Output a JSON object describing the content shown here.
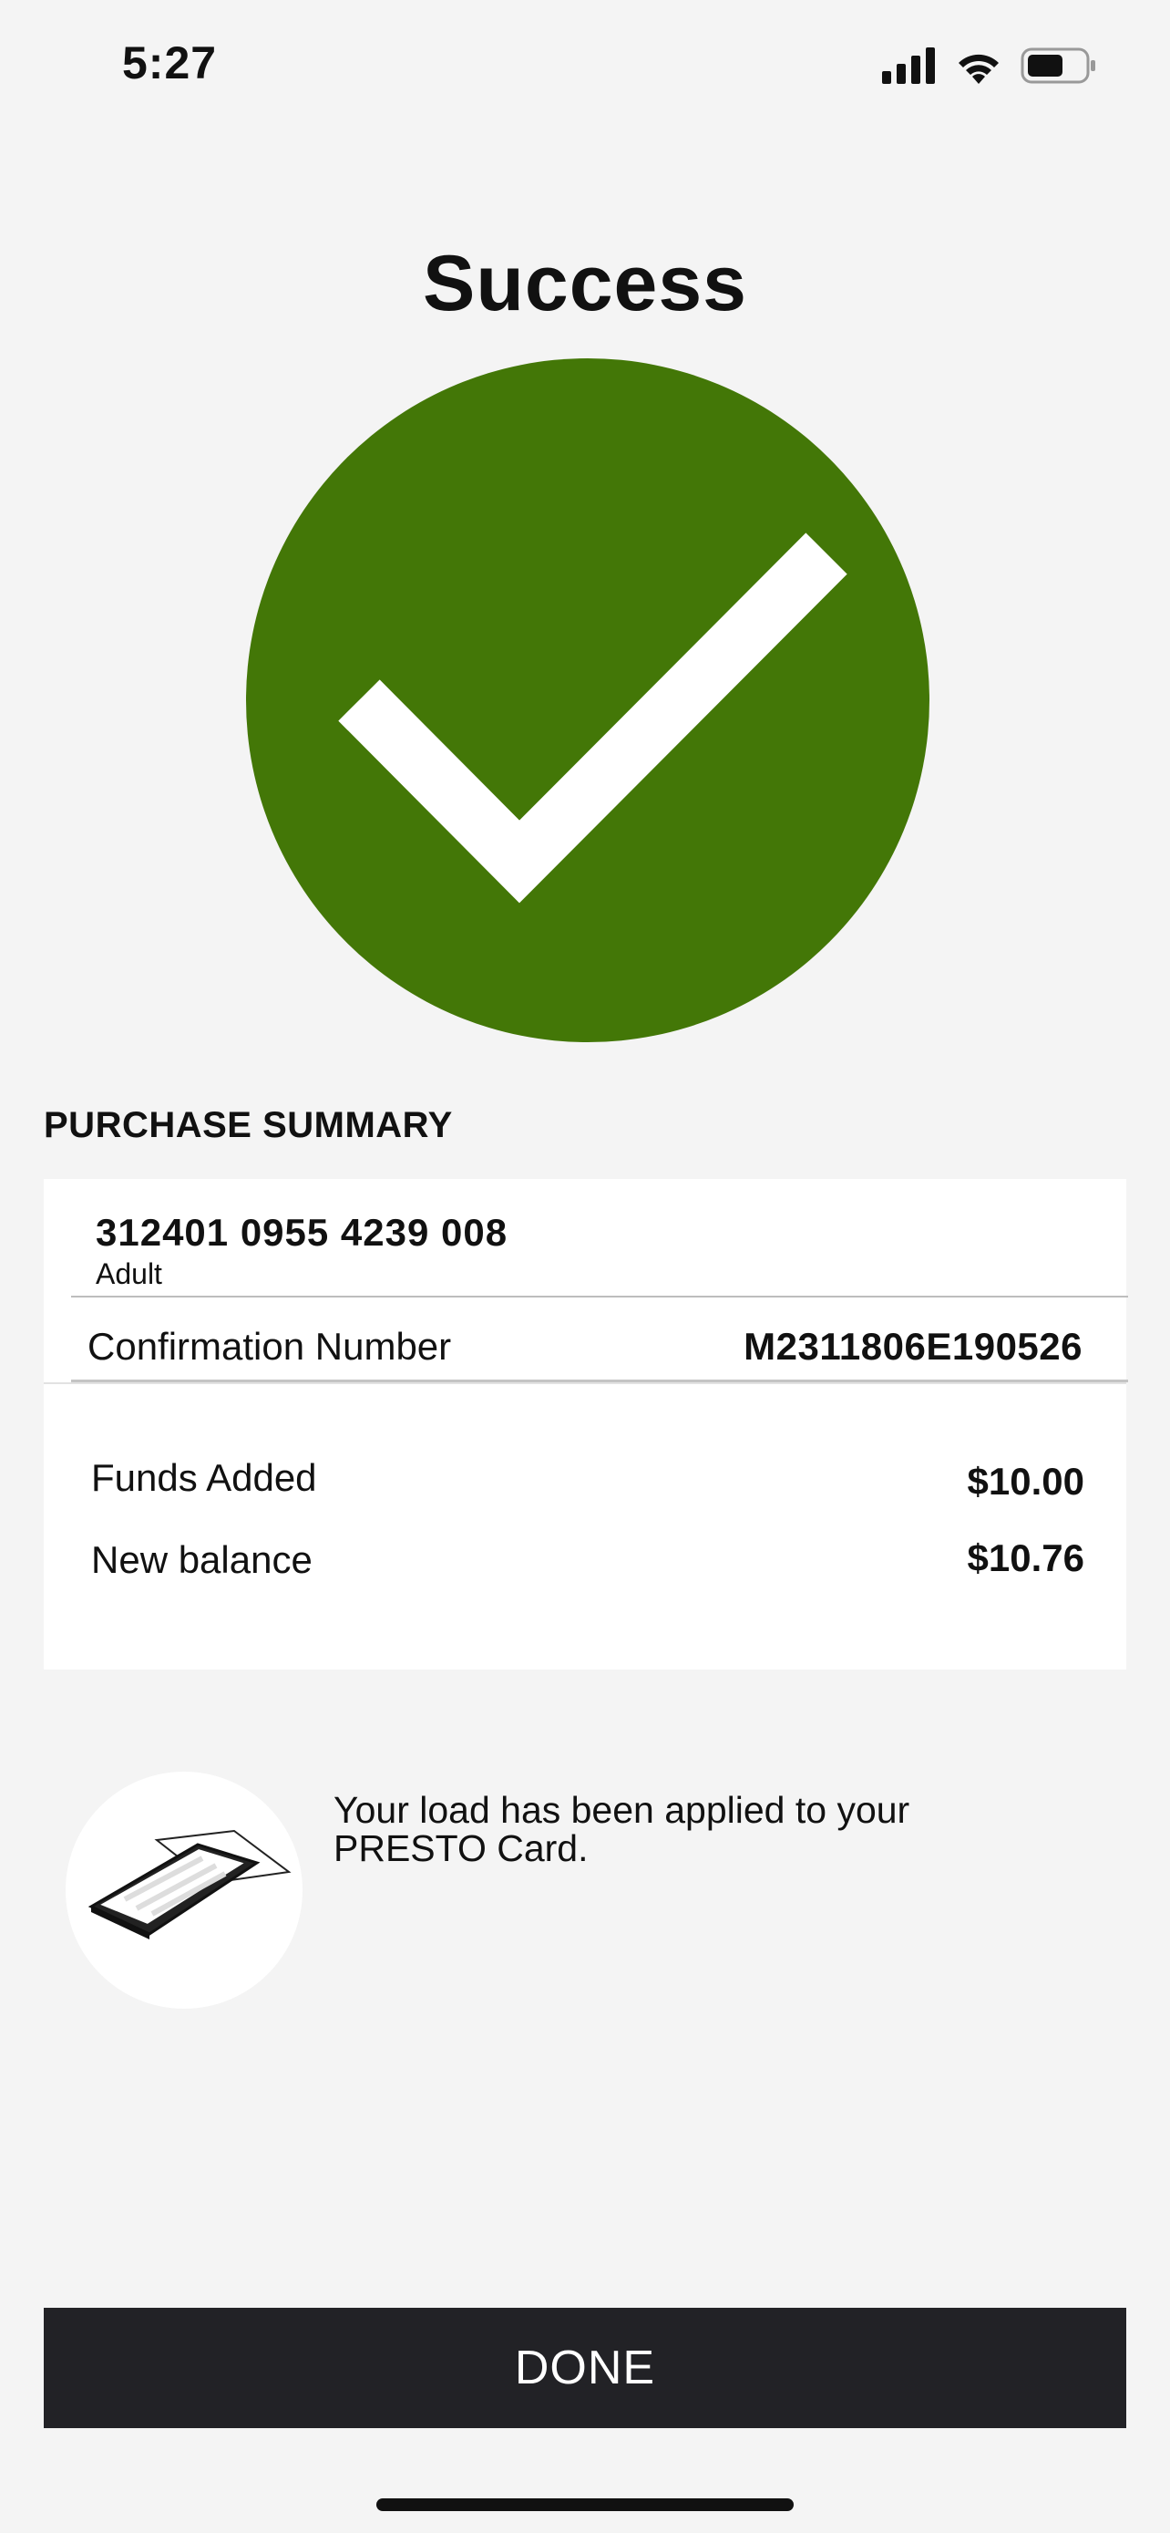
{
  "status_bar": {
    "time": "5:27",
    "icons": [
      "signal-icon",
      "wifi-icon",
      "battery-icon"
    ]
  },
  "page": {
    "title": "Success",
    "icon": "checkmark-icon",
    "accent_color": "#437707"
  },
  "summary": {
    "heading": "PURCHASE SUMMARY",
    "card_number": "312401 0955 4239 008",
    "card_type": "Adult",
    "confirmation_label": "Confirmation Number",
    "confirmation_value": "M2311806E190526",
    "funds_added_label": "Funds Added",
    "funds_added_value": "$10.00",
    "new_balance_label": "New balance",
    "new_balance_value": "$10.76"
  },
  "info": {
    "icon": "phone-tap-card-icon",
    "message": "Your load has been applied to your PRESTO Card."
  },
  "actions": {
    "done_label": "DONE"
  }
}
